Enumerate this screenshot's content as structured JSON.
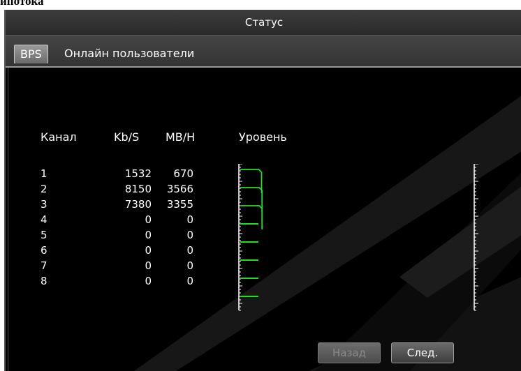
{
  "background_fragment": "ипотока",
  "window": {
    "title": "Статус"
  },
  "tabs": [
    {
      "label": "BPS",
      "active": true
    },
    {
      "label": "Онлайн пользователи",
      "active": false
    }
  ],
  "table": {
    "headers": {
      "channel": "Канал",
      "kbs": "Kb/S",
      "mbh": "MB/H",
      "level": "Уровень"
    },
    "rows": [
      {
        "channel": "1",
        "kbs": "1532",
        "mbh": "670",
        "level": 0.78
      },
      {
        "channel": "2",
        "kbs": "8150",
        "mbh": "3566",
        "level": 0.8
      },
      {
        "channel": "3",
        "kbs": "7380",
        "mbh": "3355",
        "level": 0.8
      },
      {
        "channel": "4",
        "kbs": "0",
        "mbh": "0",
        "level": 0
      },
      {
        "channel": "5",
        "kbs": "0",
        "mbh": "0",
        "level": 0
      },
      {
        "channel": "6",
        "kbs": "0",
        "mbh": "0",
        "level": 0
      },
      {
        "channel": "7",
        "kbs": "0",
        "mbh": "0",
        "level": 0
      },
      {
        "channel": "8",
        "kbs": "0",
        "mbh": "0",
        "level": 0
      }
    ]
  },
  "buttons": {
    "back": "Назад",
    "next": "След."
  },
  "colors": {
    "level_line": "#22dd22",
    "background": "#000000",
    "text": "#ffffff"
  }
}
